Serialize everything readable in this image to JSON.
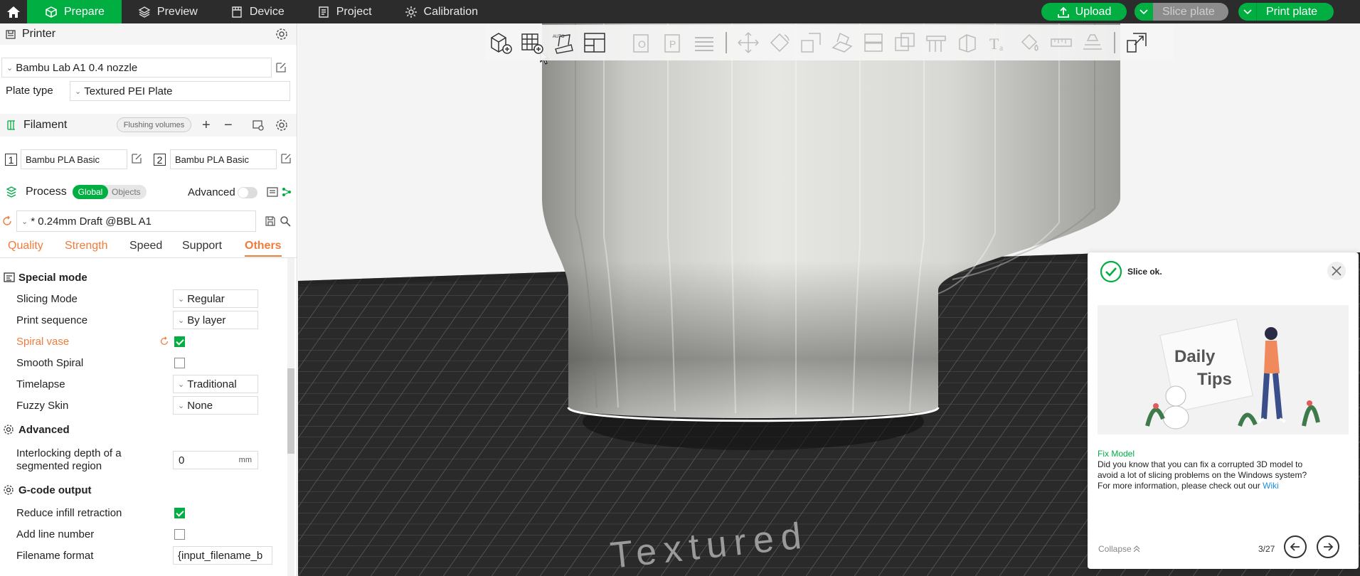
{
  "topbar": {
    "tabs": [
      {
        "label": "Prepare",
        "icon": "cube-icon",
        "active": true
      },
      {
        "label": "Preview",
        "icon": "layers-icon"
      },
      {
        "label": "Device",
        "icon": "device-icon"
      },
      {
        "label": "Project",
        "icon": "project-icon"
      },
      {
        "label": "Calibration",
        "icon": "calibration-icon"
      }
    ],
    "upload_label": "Upload",
    "slice_label": "Slice plate",
    "print_label": "Print plate",
    "accent": "#00ae42"
  },
  "printer": {
    "heading": "Printer",
    "name": "Bambu Lab A1 0.4 nozzle",
    "plate_type_label": "Plate type",
    "plate_type": "Textured PEI Plate"
  },
  "filament": {
    "heading": "Filament",
    "flushing_label": "Flushing volumes",
    "slots": [
      {
        "index": "1",
        "name": "Bambu PLA Basic"
      },
      {
        "index": "2",
        "name": "Bambu PLA Basic"
      }
    ]
  },
  "process": {
    "heading": "Process",
    "global_label": "Global",
    "objects_label": "Objects",
    "advanced_label": "Advanced",
    "preset": "* 0.24mm Draft @BBL A1",
    "tabs": [
      "Quality",
      "Strength",
      "Speed",
      "Support",
      "Others"
    ],
    "active_tab": "Others"
  },
  "settings": {
    "special_mode": {
      "heading": "Special mode",
      "slicing_mode_label": "Slicing Mode",
      "slicing_mode": "Regular",
      "print_sequence_label": "Print sequence",
      "print_sequence": "By layer",
      "spiral_vase_label": "Spiral vase",
      "smooth_spiral_label": "Smooth Spiral",
      "timelapse_label": "Timelapse",
      "timelapse": "Traditional",
      "fuzzy_skin_label": "Fuzzy Skin",
      "fuzzy_skin": "None"
    },
    "advanced": {
      "heading": "Advanced",
      "interlocking_label_1": "Interlocking depth of a",
      "interlocking_label_2": "segmented region",
      "interlocking_value": "0",
      "interlocking_unit": "mm"
    },
    "gcode": {
      "heading": "G-code output",
      "reduce_infill_label": "Reduce infill retraction",
      "add_line_number_label": "Add line number",
      "filename_format_label": "Filename format",
      "filename_format": "{input_filename_b"
    }
  },
  "notification": {
    "status": "Slice ok.",
    "tip_title": "Fix Model",
    "tip_text_1": "Did you know that you can fix a corrupted 3D model to",
    "tip_text_2": "avoid a lot of slicing problems on the Windows system?",
    "tip_text_3": "For more information, please check out our",
    "tip_link": "Wiki",
    "collapse_label": "Collapse",
    "page": "3/27",
    "image_title_1": "Daily",
    "image_title_2": "Tips"
  },
  "plate_text": "Textured"
}
